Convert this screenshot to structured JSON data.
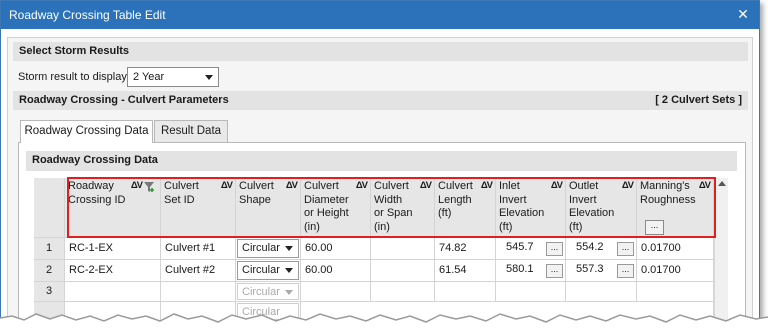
{
  "window": {
    "title": "Roadway Crossing Table Edit",
    "close_glyph": "✕"
  },
  "storm_section": {
    "header": "Select Storm Results",
    "label": "Storm result to display:",
    "selected": "2 Year"
  },
  "culvert_section": {
    "header": "Roadway Crossing - Culvert Parameters",
    "count_text": "[ 2 Culvert Sets ]"
  },
  "tabs": [
    {
      "label": "Roadway Crossing Data",
      "active": true
    },
    {
      "label": "Result Data",
      "active": false
    }
  ],
  "panel": {
    "header": "Roadway Crossing Data"
  },
  "columns": [
    {
      "lines": [
        "Roadway",
        "Crossing ID"
      ],
      "sort": "ΔV",
      "filter_icon": "filter-icon"
    },
    {
      "lines": [
        "Culvert",
        "Set ID"
      ],
      "sort": "ΔV"
    },
    {
      "lines": [
        "Culvert",
        "Shape"
      ],
      "sort": "ΔV"
    },
    {
      "lines": [
        "Culvert",
        "Diameter",
        "or Height",
        "(in)"
      ],
      "sort": "ΔV"
    },
    {
      "lines": [
        "Culvert",
        "Width",
        "or Span",
        "(in)"
      ],
      "sort": "ΔV"
    },
    {
      "lines": [
        "Culvert",
        "Length",
        "(ft)"
      ],
      "sort": "ΔV"
    },
    {
      "lines": [
        "Inlet",
        "Invert",
        "Elevation",
        "(ft)"
      ],
      "sort": "ΔV"
    },
    {
      "lines": [
        "Outlet",
        "Invert",
        "Elevation",
        "(ft)"
      ],
      "sort": "ΔV"
    },
    {
      "lines": [
        "Manning's",
        "Roughness"
      ],
      "sort": "ΔV",
      "button": "..."
    }
  ],
  "rows": [
    {
      "num": "1",
      "crossing_id": "RC-1-EX",
      "set_id": "Culvert #1",
      "shape": "Circular",
      "diameter": "60.00",
      "width": "",
      "length": "74.82",
      "inlet": "545.7",
      "outlet": "554.2",
      "roughness": "0.01700"
    },
    {
      "num": "2",
      "crossing_id": "RC-2-EX",
      "set_id": "Culvert #2",
      "shape": "Circular",
      "diameter": "60.00",
      "width": "",
      "length": "61.54",
      "inlet": "580.1",
      "outlet": "557.3",
      "roughness": "0.01700"
    },
    {
      "num": "3",
      "crossing_id": "",
      "set_id": "",
      "shape": "Circular",
      "diameter": "",
      "width": "",
      "length": "",
      "inlet": "",
      "outlet": "",
      "roughness": ""
    }
  ],
  "partial_row_shape": "Circular",
  "ellipsis": "...",
  "colors": {
    "titlebar": "#2b72ba",
    "highlight_box": "#e02020",
    "header_bg": "#e6e6e6"
  }
}
